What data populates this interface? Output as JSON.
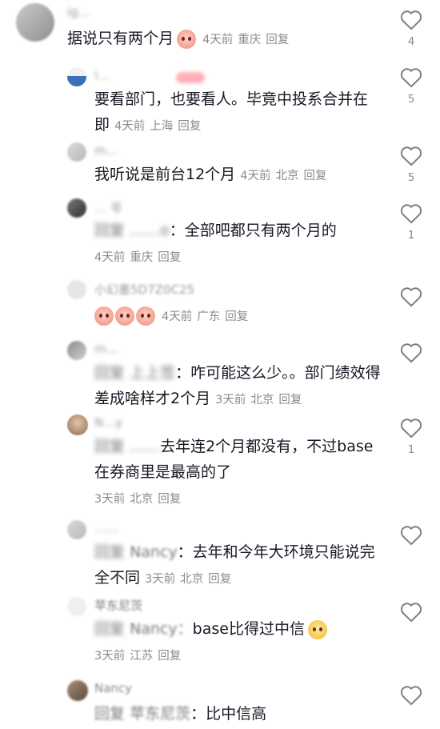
{
  "comments": [
    {
      "user": "ig… ",
      "text": "据说只有两个月",
      "time": "4天前",
      "loc": "重庆",
      "reply": "回复",
      "likes": "4"
    },
    {
      "user": "l… ",
      "text": "要看部门，也要看人。毕竟中投系合并在即",
      "time": "4天前",
      "loc": "上海",
      "reply": "回复",
      "likes": "5"
    },
    {
      "user": "m…",
      "text": "我听说是前台12个月",
      "time": "4天前",
      "loc": "北京",
      "reply": "回复",
      "likes": "5"
    },
    {
      "user": "… 苓",
      "prefix": "回复",
      "mention": "……o",
      "text": "：全部吧都只有两个月的",
      "time": "4天前",
      "loc": "重庆",
      "reply": "回复",
      "likes": "1"
    },
    {
      "user": "小幻墨5D7Z0C25",
      "text": "",
      "time": "4天前",
      "loc": "广东",
      "reply": "回复",
      "likes": ""
    },
    {
      "user": "m…",
      "prefix": "回复",
      "mention": "上上签",
      "text": "：咋可能这么少。。部门绩效得差成啥样才2个月",
      "time": "3天前",
      "loc": "北京",
      "reply": "回复",
      "likes": ""
    },
    {
      "user": "N…y",
      "prefix": "回复",
      "mention": "……",
      "text": "去年连2个月都没有，不过base在券商里是最高的了",
      "time": "3天前",
      "loc": "北京",
      "reply": "回复",
      "likes": "1"
    },
    {
      "user": "……",
      "prefix": "回复",
      "mention": "Nancy",
      "text": "：去年和今年大环境只能说完全不同",
      "time": "3天前",
      "loc": "北京",
      "reply": "回复",
      "likes": ""
    },
    {
      "user": "苹东尼茨",
      "prefix": "回复",
      "mention": "Nancy：",
      "text": "base比得过中信",
      "time": "3天前",
      "loc": "江苏",
      "reply": "回复",
      "likes": ""
    },
    {
      "user": "Nancy",
      "prefix": "回复",
      "mention": "苹东尼茨",
      "text": "：比中信高",
      "time": "",
      "loc": "",
      "reply": "",
      "likes": ""
    }
  ]
}
